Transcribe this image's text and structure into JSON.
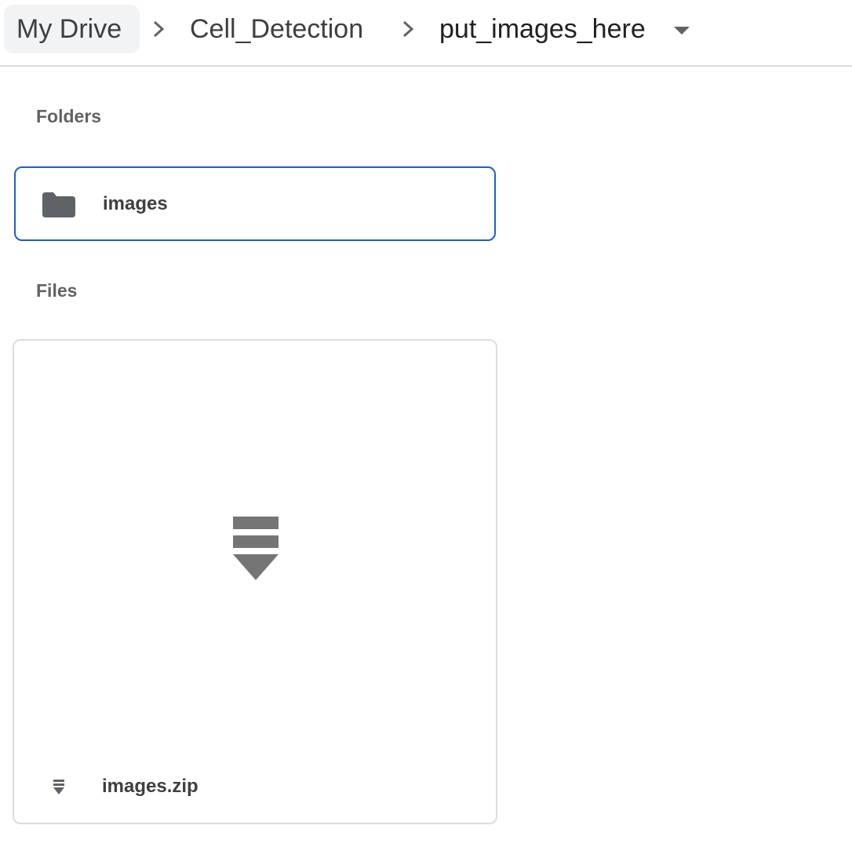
{
  "breadcrumb": {
    "items": [
      {
        "label": "My Drive"
      },
      {
        "label": "Cell_Detection"
      },
      {
        "label": "put_images_here"
      }
    ]
  },
  "sections": {
    "folders_label": "Folders",
    "files_label": "Files"
  },
  "folders": [
    {
      "name": "images",
      "icon": "folder-icon",
      "selected": true
    }
  ],
  "files": [
    {
      "name": "images.zip",
      "icon": "zip-file-icon"
    }
  ],
  "colors": {
    "selection_border": "#1a5fd0",
    "icon_gray": "#5f6368",
    "zip_gray": "#757575"
  }
}
